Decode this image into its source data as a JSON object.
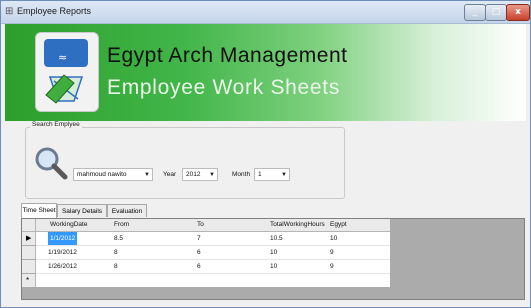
{
  "window": {
    "title": "Employee Reports"
  },
  "banner": {
    "company": "Egypt Arch Management",
    "subtitle": "Employee Work Sheets"
  },
  "search": {
    "legend": "Search Emplyee",
    "employee": "mahmoud nawito",
    "year_label": "Year",
    "year": "2012",
    "month_label": "Month",
    "month": "1"
  },
  "tabs": [
    {
      "label": "Time Sheet"
    },
    {
      "label": "Salary Details"
    },
    {
      "label": "Evaluation"
    }
  ],
  "grid": {
    "columns": [
      "WorkingDate",
      "From",
      "To",
      "TotalWorkingHours",
      "Egypt"
    ],
    "rows": [
      [
        "1/1/2012",
        "8.5",
        "7",
        "10.5",
        "10"
      ],
      [
        "1/19/2012",
        "8",
        "6",
        "10",
        "9"
      ],
      [
        "1/26/2012",
        "8",
        "6",
        "10",
        "9"
      ]
    ],
    "current_marker": "▶",
    "new_row_marker": "*"
  },
  "colors": {
    "banner_green": "#2b9e2b",
    "selection": "#3399ff"
  },
  "icons": {
    "app": "app-icon",
    "logo": "pencil-document-logo",
    "search": "magnifier-icon"
  }
}
